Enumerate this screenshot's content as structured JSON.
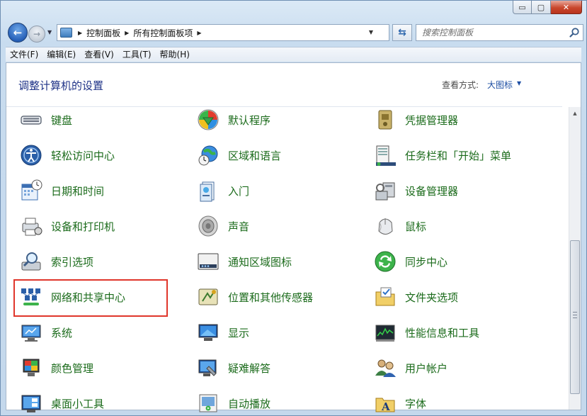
{
  "window": {
    "minimize_glyph": "▭",
    "maximize_glyph": "▢",
    "close_glyph": "✕"
  },
  "address_bar": {
    "breadcrumbs": [
      "控制面板",
      "所有控制面板项"
    ],
    "search_placeholder": "搜索控制面板"
  },
  "menu": [
    "文件(F)",
    "编辑(E)",
    "查看(V)",
    "工具(T)",
    "帮助(H)"
  ],
  "header": {
    "title": "调整计算机的设置",
    "view_label": "查看方式:",
    "view_value": "大图标"
  },
  "items": [
    [
      "键盘",
      "默认程序",
      "凭据管理器"
    ],
    [
      "轻松访问中心",
      "区域和语言",
      "任务栏和「开始」菜单"
    ],
    [
      "日期和时间",
      "入门",
      "设备管理器"
    ],
    [
      "设备和打印机",
      "声音",
      "鼠标"
    ],
    [
      "索引选项",
      "通知区域图标",
      "同步中心"
    ],
    [
      "网络和共享中心",
      "位置和其他传感器",
      "文件夹选项"
    ],
    [
      "系统",
      "显示",
      "性能信息和工具"
    ],
    [
      "颜色管理",
      "疑难解答",
      "用户帐户"
    ],
    [
      "桌面小工具",
      "自动播放",
      "字体"
    ]
  ],
  "icons": [
    [
      "keyboard-icon",
      "default-programs-icon",
      "credential-manager-icon"
    ],
    [
      "ease-of-access-icon",
      "region-language-icon",
      "taskbar-start-menu-icon"
    ],
    [
      "date-time-icon",
      "getting-started-icon",
      "device-manager-icon"
    ],
    [
      "devices-printers-icon",
      "sound-icon",
      "mouse-icon"
    ],
    [
      "indexing-options-icon",
      "notification-area-icon",
      "sync-center-icon"
    ],
    [
      "network-sharing-icon",
      "location-sensors-icon",
      "folder-options-icon"
    ],
    [
      "system-icon",
      "display-icon",
      "performance-icon"
    ],
    [
      "color-management-icon",
      "troubleshooting-icon",
      "user-accounts-icon"
    ],
    [
      "desktop-gadgets-icon",
      "autoplay-icon",
      "fonts-icon"
    ]
  ],
  "colors": {
    "item_text": "#1b6b1b",
    "title_text": "#1e3287",
    "highlight_box": "#e0362b"
  },
  "highlighted_item": "网络和共享中心"
}
